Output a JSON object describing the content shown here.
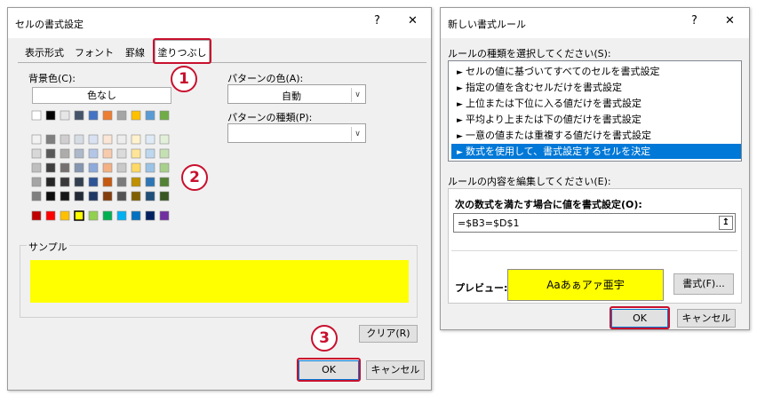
{
  "dialog1": {
    "title": "セルの書式設定",
    "help": "?",
    "close": "✕",
    "tabs": [
      "表示形式",
      "フォント",
      "罫線",
      "塗りつぶし"
    ],
    "bg_label": "背景色(C):",
    "no_color": "色なし",
    "pattern_color_label": "パターンの色(A):",
    "pattern_color_value": "自動",
    "pattern_type_label": "パターンの種類(P):",
    "sample_label": "サンプル",
    "sample_color": "#ffff00",
    "clear": "クリア(R)",
    "ok": "OK",
    "cancel": "キャンセル",
    "selected_color": "#ffff00",
    "palette": {
      "row1": [
        "#ffffff",
        "#000000",
        "#e7e6e6",
        "#44546a",
        "#4472c4",
        "#ed7d31",
        "#a5a5a5",
        "#ffc000",
        "#5b9bd5",
        "#70ad47"
      ],
      "tint_rows": [
        [
          "#f2f2f2",
          "#7f7f7f",
          "#d0cece",
          "#d6dce4",
          "#d9e2f3",
          "#fbe5d5",
          "#ededed",
          "#fff2cc",
          "#deebf6",
          "#e2efd9"
        ],
        [
          "#d8d8d8",
          "#595959",
          "#aeabab",
          "#adb9ca",
          "#b4c6e7",
          "#f7cbac",
          "#dbdbdb",
          "#fee599",
          "#bdd7ee",
          "#c5e0b3"
        ],
        [
          "#bfbfbf",
          "#3f3f3f",
          "#757070",
          "#8496b0",
          "#8eaadb",
          "#f4b183",
          "#c9c9c9",
          "#ffd965",
          "#9cc3e5",
          "#a8d08d"
        ],
        [
          "#a5a5a5",
          "#262626",
          "#3a3838",
          "#323f4f",
          "#2f5496",
          "#c55a11",
          "#7b7b7b",
          "#bf9000",
          "#2e75b5",
          "#538135"
        ],
        [
          "#7f7f7f",
          "#0c0c0c",
          "#171616",
          "#222a35",
          "#1f3864",
          "#833c0b",
          "#525252",
          "#7f6000",
          "#1e4e79",
          "#375623"
        ]
      ],
      "standard": [
        "#c00000",
        "#ff0000",
        "#ffc000",
        "#ffff00",
        "#92d050",
        "#00b050",
        "#00b0f0",
        "#0070c0",
        "#002060",
        "#7030a0"
      ]
    }
  },
  "dialog2": {
    "title": "新しい書式ルール",
    "help": "?",
    "close": "✕",
    "rule_type_label": "ルールの種類を選択してください(S):",
    "rule_types": [
      "セルの値に基づいてすべてのセルを書式設定",
      "指定の値を含むセルだけを書式設定",
      "上位または下位に入る値だけを書式設定",
      "平均より上または下の値だけを書式設定",
      "一意の値または重複する値だけを書式設定",
      "数式を使用して、書式設定するセルを決定"
    ],
    "edit_label": "ルールの内容を編集してください(E):",
    "formula_label": "次の数式を満たす場合に値を書式設定(O):",
    "formula": "=$B3=$D$1",
    "preview_label": "プレビュー:",
    "preview_text": "Aaあぁアァ亜宇",
    "preview_color": "#ffff00",
    "format_button": "書式(F)...",
    "ok": "OK",
    "cancel": "キャンセル",
    "selection_color": "#0078d7"
  },
  "callouts": [
    "1",
    "2",
    "3"
  ],
  "highlight_color": "#c8102e"
}
